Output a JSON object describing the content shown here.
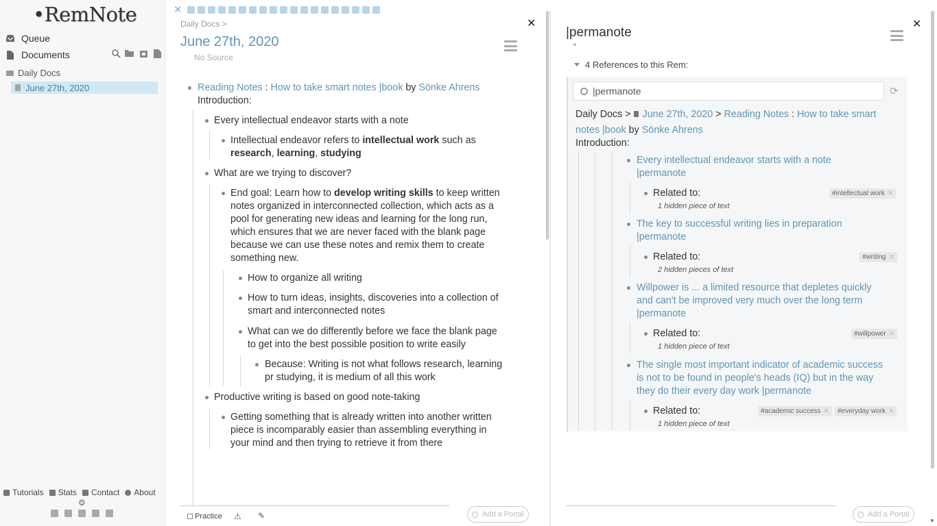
{
  "sidebar": {
    "logo": "•RemNote",
    "queue": "Queue",
    "documents": "Documents",
    "tree": {
      "daily_docs": "Daily Docs",
      "selected_doc": "June 27th, 2020"
    },
    "footer": {
      "tutorials": "Tutorials",
      "stats": "Stats",
      "contact": "Contact",
      "about": "About"
    }
  },
  "left_pane": {
    "breadcrumb": "Daily Docs >",
    "title": "June 27th, 2020",
    "no_source": "No Source",
    "rows": {
      "r1a": "Reading Notes",
      "r1b": " : ",
      "r1c": "How to take smart notes |book",
      "r1d": " by ",
      "r1e": "Sönke Ahrens",
      "r2": "Introduction:",
      "r3": "Every intellectual endeavor starts with a note",
      "r4a": "Intellectual endeavor refers to ",
      "r4b": "intellectual work",
      "r4c": " such as",
      "r5a": "research",
      "r5b": ", ",
      "r5c": "learning",
      "r5d": ", ",
      "r5e": "studying",
      "r6": "What are we trying to discover?",
      "r7a": "End goal: Learn how to ",
      "r7b": "develop writing skills",
      "r7c": " to keep written",
      "r8": "notes organized in interconnected collection, which acts as a",
      "r9": "pool for generating new ideas and learning for the long run,",
      "r10": "which ensures that we are never faced with the blank page",
      "r11": "because we can use these notes and remix them to create",
      "r12": "something new.",
      "r13": "How to organize all writing",
      "r14": "How to turn ideas, insights, discoveries into a collection of",
      "r15": "smart and interconnected notes",
      "r16": "What can we do differently before we face the blank page",
      "r17": "to get into the best possible position to write easily",
      "r18": "Because: Writing is not what follows research, learning",
      "r19": "pr studying, it is medium of all this work",
      "r20": "Productive writing is based on good note-taking",
      "r21": "Getting something that is already written into another written",
      "r22": "piece is incomparably easier than assembling everything in",
      "r23": "your mind and then trying to retrieve it from there"
    },
    "footer": {
      "practice": "Practice",
      "portal_placeholder": "Add a Portal"
    }
  },
  "right_pane": {
    "title": "|permanote",
    "refs_header": "4 References to this Rem:",
    "search_value": "|permanote",
    "path": {
      "daily": "Daily Docs",
      "sep1": " > ",
      "doc": "June 27th, 2020",
      "sep2": " > ",
      "reading": "Reading Notes",
      "colon": " : ",
      "how_a": "How to take smart",
      "how_b": "notes |book",
      "by": " by ",
      "author": "Sönke Ahrens"
    },
    "intro": "Introduction:",
    "refs": [
      {
        "l1": "Every intellectual endeavor starts with a note",
        "l2": "|permanote",
        "related": "Related to:",
        "hidden": "1 hidden piece of text",
        "tags": [
          "#intellectual work"
        ]
      },
      {
        "l1": "The key to successful writing lies in preparation",
        "l2": "|permanote",
        "related": "Related to:",
        "hidden": "2 hidden pieces of text",
        "tags": [
          "#writing"
        ]
      },
      {
        "l1": "Willpower is ... a limited resource that depletes quickly",
        "l2": "and can't be improved very much over the long term",
        "l3": "|permanote",
        "related": "Related to:",
        "hidden": "1 hidden piece of text",
        "tags": [
          "#willpower"
        ]
      },
      {
        "l1": "The single most important indicator of academic success",
        "l2": "is not to be found in people's heads (IQ) but in the way",
        "l3": "they do their every day work  |permanote",
        "related": "Related to:",
        "hidden": "1 hidden piece of text",
        "tags": [
          "#academic success",
          "#everyday work"
        ]
      }
    ],
    "footer": {
      "portal_placeholder": "Add a Portal"
    }
  },
  "icons": {
    "queue": "inbox-icon",
    "documents": "document-icon",
    "search": "search-icon",
    "new_folder": "new-folder-icon",
    "import": "import-icon",
    "new_doc": "new-document-icon",
    "settings": "gear-icon",
    "menu": "hamburger-icon",
    "close": "close-icon",
    "refresh": "refresh-icon"
  },
  "colors": {
    "link": "#5f95b5",
    "selected_bg": "#d1e8f3",
    "tab_square": "#b9d4e7"
  }
}
